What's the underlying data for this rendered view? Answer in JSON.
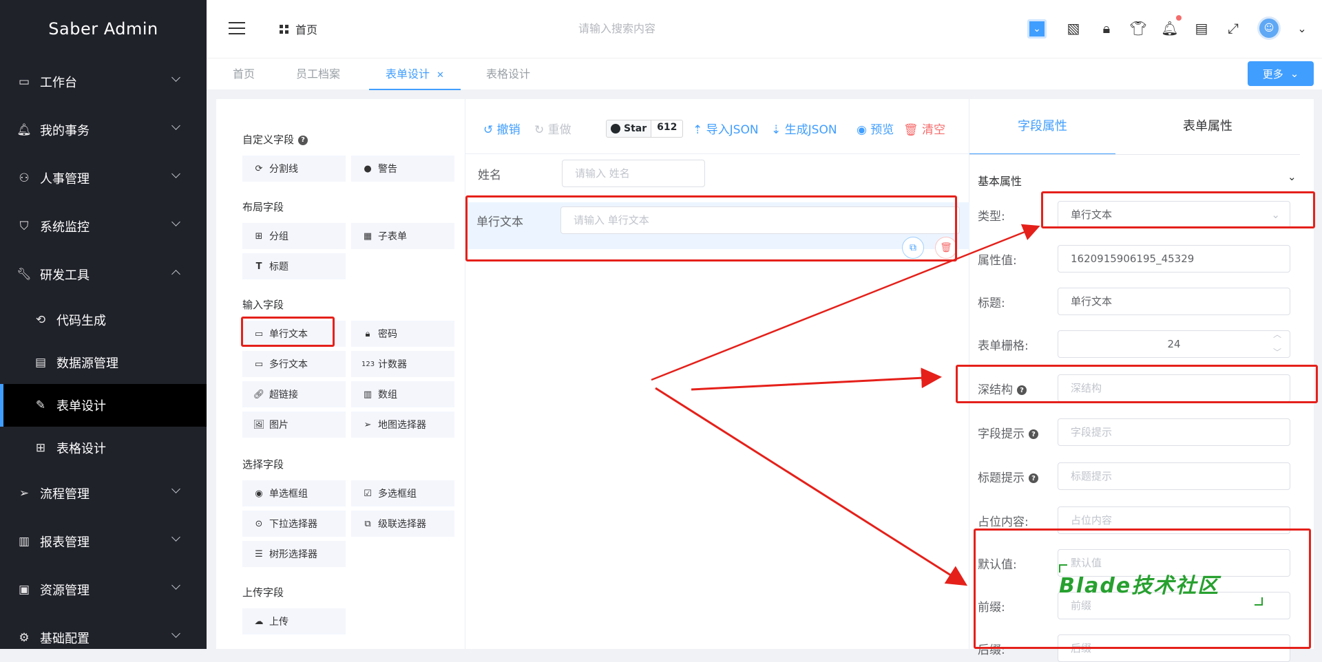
{
  "sidebar": {
    "logo": "Saber Admin",
    "items": [
      {
        "label": "工作台",
        "icon": "monitor-icon"
      },
      {
        "label": "我的事务",
        "icon": "bell-icon"
      },
      {
        "label": "人事管理",
        "icon": "users-icon"
      },
      {
        "label": "系统监控",
        "icon": "shield-icon"
      },
      {
        "label": "研发工具",
        "icon": "wrench-icon"
      },
      {
        "label": "代码生成",
        "icon": "code-icon"
      },
      {
        "label": "数据源管理",
        "icon": "database-icon"
      },
      {
        "label": "表单设计",
        "icon": "edit-icon"
      },
      {
        "label": "表格设计",
        "icon": "grid-icon"
      },
      {
        "label": "流程管理",
        "icon": "send-icon"
      },
      {
        "label": "报表管理",
        "icon": "bar-chart-icon"
      },
      {
        "label": "资源管理",
        "icon": "wallet-icon"
      },
      {
        "label": "基础配置",
        "icon": "settings-icon"
      }
    ]
  },
  "header": {
    "home_label": "首页",
    "search_placeholder": "请输入搜索内容"
  },
  "tabs": [
    {
      "label": "首页"
    },
    {
      "label": "员工档案"
    },
    {
      "label": "表单设计"
    },
    {
      "label": "表格设计"
    }
  ],
  "more_button": "更多",
  "palette": {
    "custom_title": "自定义字段",
    "custom_items": [
      "分割线",
      "警告"
    ],
    "layout_title": "布局字段",
    "layout_items": [
      "分组",
      "子表单",
      "标题"
    ],
    "input_title": "输入字段",
    "input_items": [
      "单行文本",
      "密码",
      "多行文本",
      "计数器",
      "超链接",
      "数组",
      "图片",
      "地图选择器"
    ],
    "select_title": "选择字段",
    "select_items": [
      "单选框组",
      "多选框组",
      "下拉选择器",
      "级联选择器",
      "树形选择器"
    ],
    "upload_title": "上传字段",
    "upload_items": [
      "上传"
    ]
  },
  "toolbar": {
    "undo": "撤销",
    "redo": "重做",
    "star": "Star",
    "star_count": "612",
    "import": "导入JSON",
    "generate": "生成JSON",
    "preview": "预览",
    "clear": "清空"
  },
  "canvas": {
    "field1_label": "姓名",
    "field1_placeholder": "请输入 姓名",
    "field2_label": "单行文本",
    "field2_placeholder": "请输入 单行文本"
  },
  "props": {
    "tab_field": "字段属性",
    "tab_form": "表单属性",
    "section": "基本属性",
    "type_label": "类型:",
    "type_value": "单行文本",
    "prop_label": "属性值:",
    "prop_value": "1620915906195_45329",
    "title_label": "标题:",
    "title_value": "单行文本",
    "grid_label": "表单栅格:",
    "grid_value": "24",
    "deep_label": "深结构",
    "deep_placeholder": "深结构",
    "fieldtip_label": "字段提示",
    "fieldtip_placeholder": "字段提示",
    "titletip_label": "标题提示",
    "titletip_placeholder": "标题提示",
    "placeholder_label": "占位内容:",
    "placeholder_placeholder": "占位内容",
    "default_label": "默认值:",
    "default_placeholder": "默认值",
    "prefix_label": "前缀:",
    "prefix_placeholder": "前缀",
    "suffix_label": "后缀:",
    "suffix_placeholder": "后缀"
  },
  "watermark": "Blade技术社区",
  "colors": {
    "primary": "#409eff",
    "sidebar_bg": "#20222a",
    "annotation_red": "#e5201a",
    "watermark_green": "#27a02f"
  }
}
